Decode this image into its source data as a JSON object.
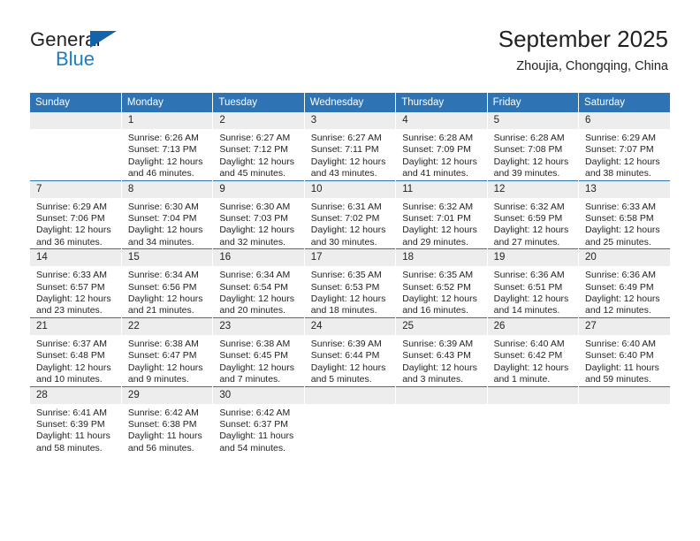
{
  "logo": {
    "word_top": "General",
    "word_bottom": "Blue",
    "triangle_color": "#1263a8",
    "blue_color": "#1d7dc4"
  },
  "header": {
    "title": "September 2025",
    "subtitle": "Zhoujia, Chongqing, China"
  },
  "colors": {
    "header_blue": "#2e74b5",
    "daynum_gray": "#ededed",
    "text": "#231f20"
  },
  "weekdays": [
    "Sunday",
    "Monday",
    "Tuesday",
    "Wednesday",
    "Thursday",
    "Friday",
    "Saturday"
  ],
  "weeks": [
    [
      {
        "day": "",
        "sunrise": "",
        "sunset": "",
        "daylight1": "",
        "daylight2": ""
      },
      {
        "day": "1",
        "sunrise": "Sunrise: 6:26 AM",
        "sunset": "Sunset: 7:13 PM",
        "daylight1": "Daylight: 12 hours",
        "daylight2": "and 46 minutes."
      },
      {
        "day": "2",
        "sunrise": "Sunrise: 6:27 AM",
        "sunset": "Sunset: 7:12 PM",
        "daylight1": "Daylight: 12 hours",
        "daylight2": "and 45 minutes."
      },
      {
        "day": "3",
        "sunrise": "Sunrise: 6:27 AM",
        "sunset": "Sunset: 7:11 PM",
        "daylight1": "Daylight: 12 hours",
        "daylight2": "and 43 minutes."
      },
      {
        "day": "4",
        "sunrise": "Sunrise: 6:28 AM",
        "sunset": "Sunset: 7:09 PM",
        "daylight1": "Daylight: 12 hours",
        "daylight2": "and 41 minutes."
      },
      {
        "day": "5",
        "sunrise": "Sunrise: 6:28 AM",
        "sunset": "Sunset: 7:08 PM",
        "daylight1": "Daylight: 12 hours",
        "daylight2": "and 39 minutes."
      },
      {
        "day": "6",
        "sunrise": "Sunrise: 6:29 AM",
        "sunset": "Sunset: 7:07 PM",
        "daylight1": "Daylight: 12 hours",
        "daylight2": "and 38 minutes."
      }
    ],
    [
      {
        "day": "7",
        "sunrise": "Sunrise: 6:29 AM",
        "sunset": "Sunset: 7:06 PM",
        "daylight1": "Daylight: 12 hours",
        "daylight2": "and 36 minutes."
      },
      {
        "day": "8",
        "sunrise": "Sunrise: 6:30 AM",
        "sunset": "Sunset: 7:04 PM",
        "daylight1": "Daylight: 12 hours",
        "daylight2": "and 34 minutes."
      },
      {
        "day": "9",
        "sunrise": "Sunrise: 6:30 AM",
        "sunset": "Sunset: 7:03 PM",
        "daylight1": "Daylight: 12 hours",
        "daylight2": "and 32 minutes."
      },
      {
        "day": "10",
        "sunrise": "Sunrise: 6:31 AM",
        "sunset": "Sunset: 7:02 PM",
        "daylight1": "Daylight: 12 hours",
        "daylight2": "and 30 minutes."
      },
      {
        "day": "11",
        "sunrise": "Sunrise: 6:32 AM",
        "sunset": "Sunset: 7:01 PM",
        "daylight1": "Daylight: 12 hours",
        "daylight2": "and 29 minutes."
      },
      {
        "day": "12",
        "sunrise": "Sunrise: 6:32 AM",
        "sunset": "Sunset: 6:59 PM",
        "daylight1": "Daylight: 12 hours",
        "daylight2": "and 27 minutes."
      },
      {
        "day": "13",
        "sunrise": "Sunrise: 6:33 AM",
        "sunset": "Sunset: 6:58 PM",
        "daylight1": "Daylight: 12 hours",
        "daylight2": "and 25 minutes."
      }
    ],
    [
      {
        "day": "14",
        "sunrise": "Sunrise: 6:33 AM",
        "sunset": "Sunset: 6:57 PM",
        "daylight1": "Daylight: 12 hours",
        "daylight2": "and 23 minutes."
      },
      {
        "day": "15",
        "sunrise": "Sunrise: 6:34 AM",
        "sunset": "Sunset: 6:56 PM",
        "daylight1": "Daylight: 12 hours",
        "daylight2": "and 21 minutes."
      },
      {
        "day": "16",
        "sunrise": "Sunrise: 6:34 AM",
        "sunset": "Sunset: 6:54 PM",
        "daylight1": "Daylight: 12 hours",
        "daylight2": "and 20 minutes."
      },
      {
        "day": "17",
        "sunrise": "Sunrise: 6:35 AM",
        "sunset": "Sunset: 6:53 PM",
        "daylight1": "Daylight: 12 hours",
        "daylight2": "and 18 minutes."
      },
      {
        "day": "18",
        "sunrise": "Sunrise: 6:35 AM",
        "sunset": "Sunset: 6:52 PM",
        "daylight1": "Daylight: 12 hours",
        "daylight2": "and 16 minutes."
      },
      {
        "day": "19",
        "sunrise": "Sunrise: 6:36 AM",
        "sunset": "Sunset: 6:51 PM",
        "daylight1": "Daylight: 12 hours",
        "daylight2": "and 14 minutes."
      },
      {
        "day": "20",
        "sunrise": "Sunrise: 6:36 AM",
        "sunset": "Sunset: 6:49 PM",
        "daylight1": "Daylight: 12 hours",
        "daylight2": "and 12 minutes."
      }
    ],
    [
      {
        "day": "21",
        "sunrise": "Sunrise: 6:37 AM",
        "sunset": "Sunset: 6:48 PM",
        "daylight1": "Daylight: 12 hours",
        "daylight2": "and 10 minutes."
      },
      {
        "day": "22",
        "sunrise": "Sunrise: 6:38 AM",
        "sunset": "Sunset: 6:47 PM",
        "daylight1": "Daylight: 12 hours",
        "daylight2": "and 9 minutes."
      },
      {
        "day": "23",
        "sunrise": "Sunrise: 6:38 AM",
        "sunset": "Sunset: 6:45 PM",
        "daylight1": "Daylight: 12 hours",
        "daylight2": "and 7 minutes."
      },
      {
        "day": "24",
        "sunrise": "Sunrise: 6:39 AM",
        "sunset": "Sunset: 6:44 PM",
        "daylight1": "Daylight: 12 hours",
        "daylight2": "and 5 minutes."
      },
      {
        "day": "25",
        "sunrise": "Sunrise: 6:39 AM",
        "sunset": "Sunset: 6:43 PM",
        "daylight1": "Daylight: 12 hours",
        "daylight2": "and 3 minutes."
      },
      {
        "day": "26",
        "sunrise": "Sunrise: 6:40 AM",
        "sunset": "Sunset: 6:42 PM",
        "daylight1": "Daylight: 12 hours",
        "daylight2": "and 1 minute."
      },
      {
        "day": "27",
        "sunrise": "Sunrise: 6:40 AM",
        "sunset": "Sunset: 6:40 PM",
        "daylight1": "Daylight: 11 hours",
        "daylight2": "and 59 minutes."
      }
    ],
    [
      {
        "day": "28",
        "sunrise": "Sunrise: 6:41 AM",
        "sunset": "Sunset: 6:39 PM",
        "daylight1": "Daylight: 11 hours",
        "daylight2": "and 58 minutes."
      },
      {
        "day": "29",
        "sunrise": "Sunrise: 6:42 AM",
        "sunset": "Sunset: 6:38 PM",
        "daylight1": "Daylight: 11 hours",
        "daylight2": "and 56 minutes."
      },
      {
        "day": "30",
        "sunrise": "Sunrise: 6:42 AM",
        "sunset": "Sunset: 6:37 PM",
        "daylight1": "Daylight: 11 hours",
        "daylight2": "and 54 minutes."
      },
      {
        "day": "",
        "sunrise": "",
        "sunset": "",
        "daylight1": "",
        "daylight2": ""
      },
      {
        "day": "",
        "sunrise": "",
        "sunset": "",
        "daylight1": "",
        "daylight2": ""
      },
      {
        "day": "",
        "sunrise": "",
        "sunset": "",
        "daylight1": "",
        "daylight2": ""
      },
      {
        "day": "",
        "sunrise": "",
        "sunset": "",
        "daylight1": "",
        "daylight2": ""
      }
    ]
  ]
}
